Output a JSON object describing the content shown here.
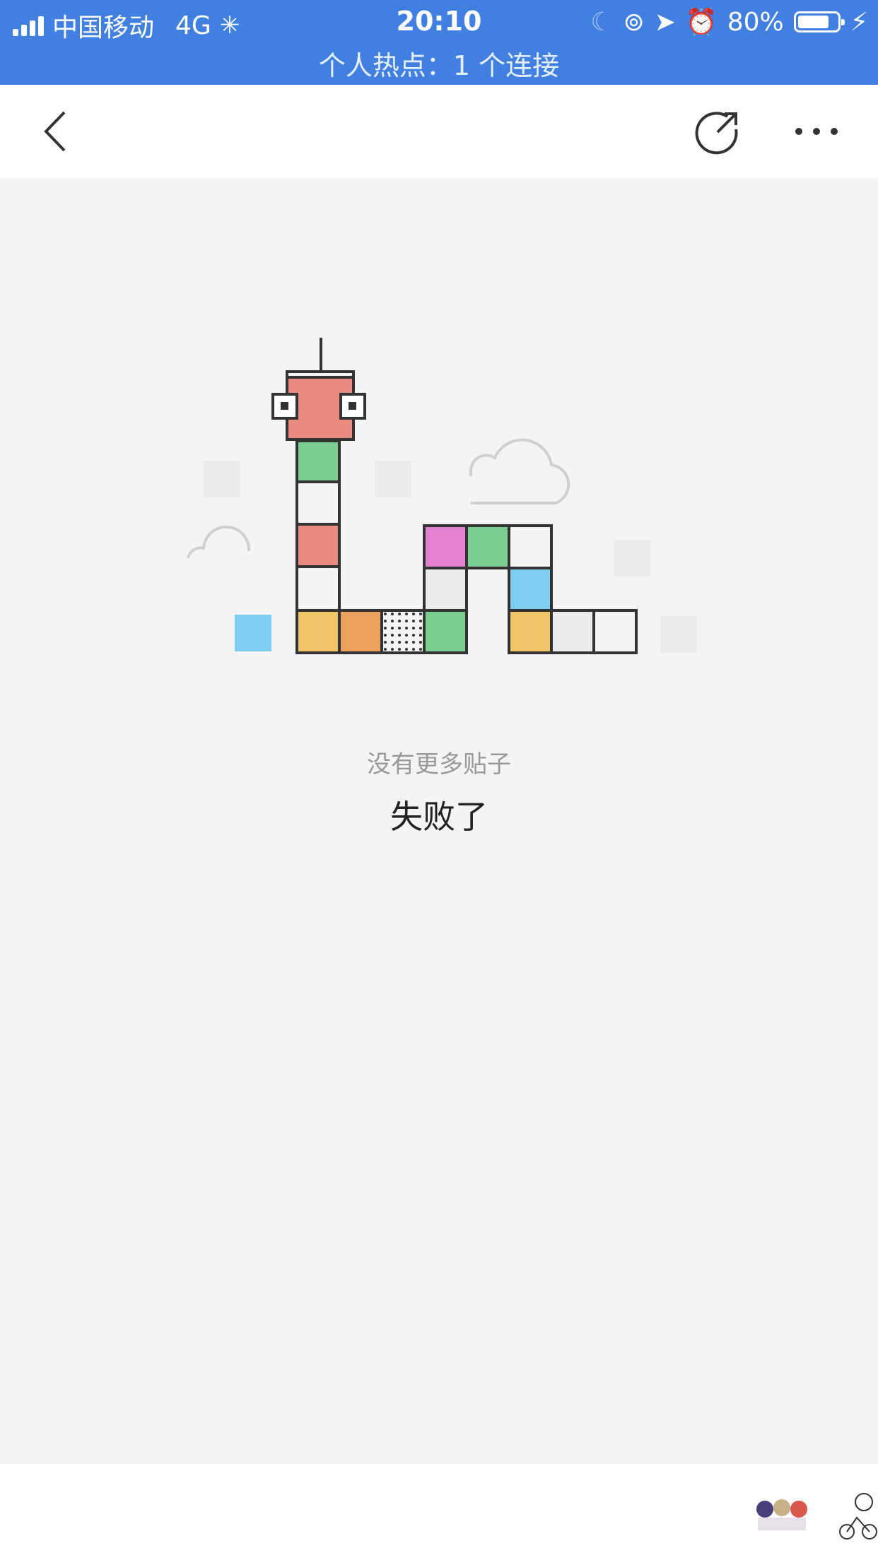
{
  "status_bar": {
    "carrier": "中国移动",
    "network": "4G",
    "time": "20:10",
    "battery": "80%",
    "battery_level": 0.8,
    "hotspot": "个人热点：1 个连接",
    "background_color": "#4180e0"
  },
  "nav": {
    "back_icon": "chevron-left-icon",
    "share_icon": "share-icon",
    "more_icon": "more-dots-icon"
  },
  "empty_state": {
    "subtitle": "没有更多贴子",
    "title": "失败了",
    "illustration_icon": "block-snake-illustration"
  },
  "bottom_bar": {
    "stickers": [
      "anime-group-sticker",
      "cyclist-sticker"
    ]
  }
}
